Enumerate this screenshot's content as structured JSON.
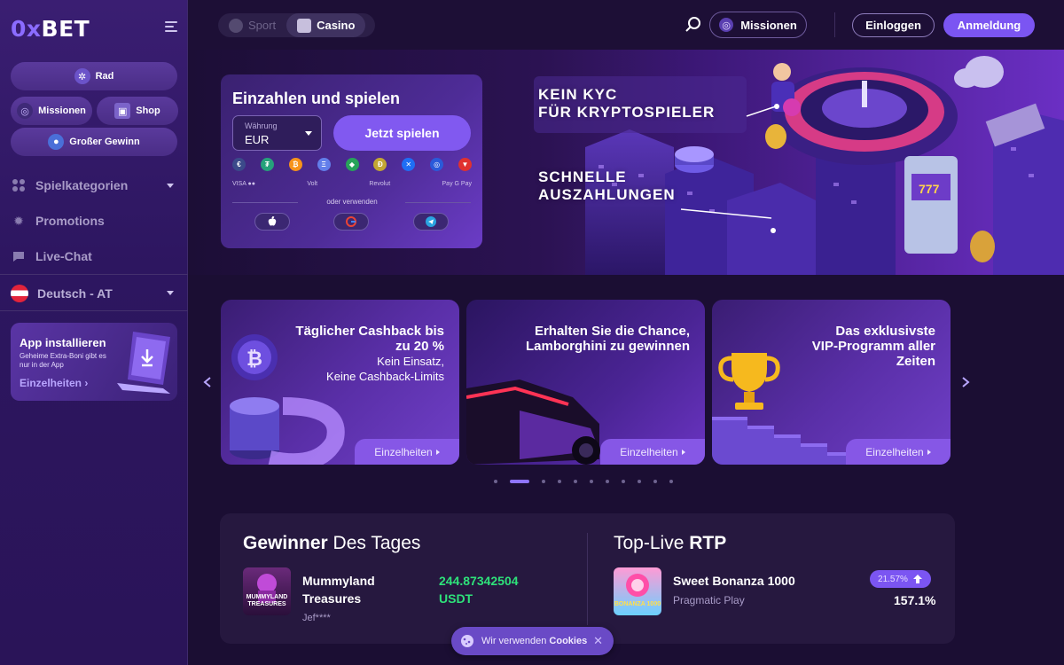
{
  "brand": {
    "logo_prefix": "0x",
    "logo_suffix": "BET"
  },
  "sidebar": {
    "pills": {
      "wheel": "Rad",
      "missions": "Missionen",
      "shop": "Shop",
      "big_win": "Großer Gewinn"
    },
    "nav": [
      {
        "label": "Spielkategorien",
        "icon": "grid-icon"
      },
      {
        "label": "Promotions",
        "icon": "gear-icon"
      },
      {
        "label": "Live-Chat",
        "icon": "chat-icon"
      }
    ],
    "language": "Deutsch - AT",
    "app_card": {
      "title": "App installieren",
      "subtitle": "Geheime Extra-Boni gibt es nur in der App",
      "link": "Einzelheiten"
    }
  },
  "topbar": {
    "tabs": [
      {
        "label": "Sport",
        "active": false
      },
      {
        "label": "Casino",
        "active": true
      }
    ],
    "missions_button": "Missionen",
    "login_button": "Einloggen",
    "register_button": "Anmeldung"
  },
  "deposit": {
    "title": "Einzahlen und spielen",
    "currency_label": "Währung",
    "currency_value": "EUR",
    "play_button": "Jetzt spielen",
    "coins": [
      "€",
      "₮",
      "₿",
      "Ξ",
      "◆",
      "Ð",
      "✕",
      "◎",
      "▼"
    ],
    "payment_methods": [
      "VISA ●●",
      "Volt",
      "Revolut",
      " Pay G Pay"
    ],
    "or_use": "oder verwenden"
  },
  "hero": {
    "line1": "KEIN KYC",
    "line2": "FÜR KRYPTOSPIELER",
    "line3": "SCHNELLE",
    "line4": "AUSZAHLUNGEN"
  },
  "promos": [
    {
      "title": "Täglicher Cashback bis zu 20 %",
      "subtitle_1": "Kein Einsatz,",
      "subtitle_2": "Keine Cashback-Limits",
      "button": "Einzelheiten"
    },
    {
      "title_1": "Erhalten Sie die Chance,",
      "title_2": "Lamborghini zu gewinnen",
      "button": "Einzelheiten"
    },
    {
      "title_1": "Das exklusivste",
      "title_2": "VIP-Programm aller",
      "title_3": "Zeiten",
      "button": "Einzelheiten"
    }
  ],
  "carousel": {
    "total_dots": 12,
    "active_index": 1
  },
  "winners": {
    "title_bold": "Gewinner",
    "title_rest": " Des Tages",
    "game_line1": "Mummyland",
    "game_line2": "Treasures",
    "game_thumb_1": "MUMMYLAND",
    "game_thumb_2": "TREASURES",
    "user": "Jef****",
    "amount": "244.87342504",
    "currency": "USDT"
  },
  "rtp": {
    "title_rest": "Top-Live ",
    "title_bold": "RTP",
    "game": "Sweet Bonanza 1000",
    "game_thumb": "BONANZA 1000",
    "provider": "Pragmatic Play",
    "badge": "21.57%",
    "value": "157.1%"
  },
  "cookie": {
    "text": "Wir verwenden ",
    "bold": "Cookies",
    "close": "✕"
  },
  "colors": {
    "accent": "#7b55f2",
    "win_green": "#2ee27a",
    "bg": "#1b0e33"
  }
}
